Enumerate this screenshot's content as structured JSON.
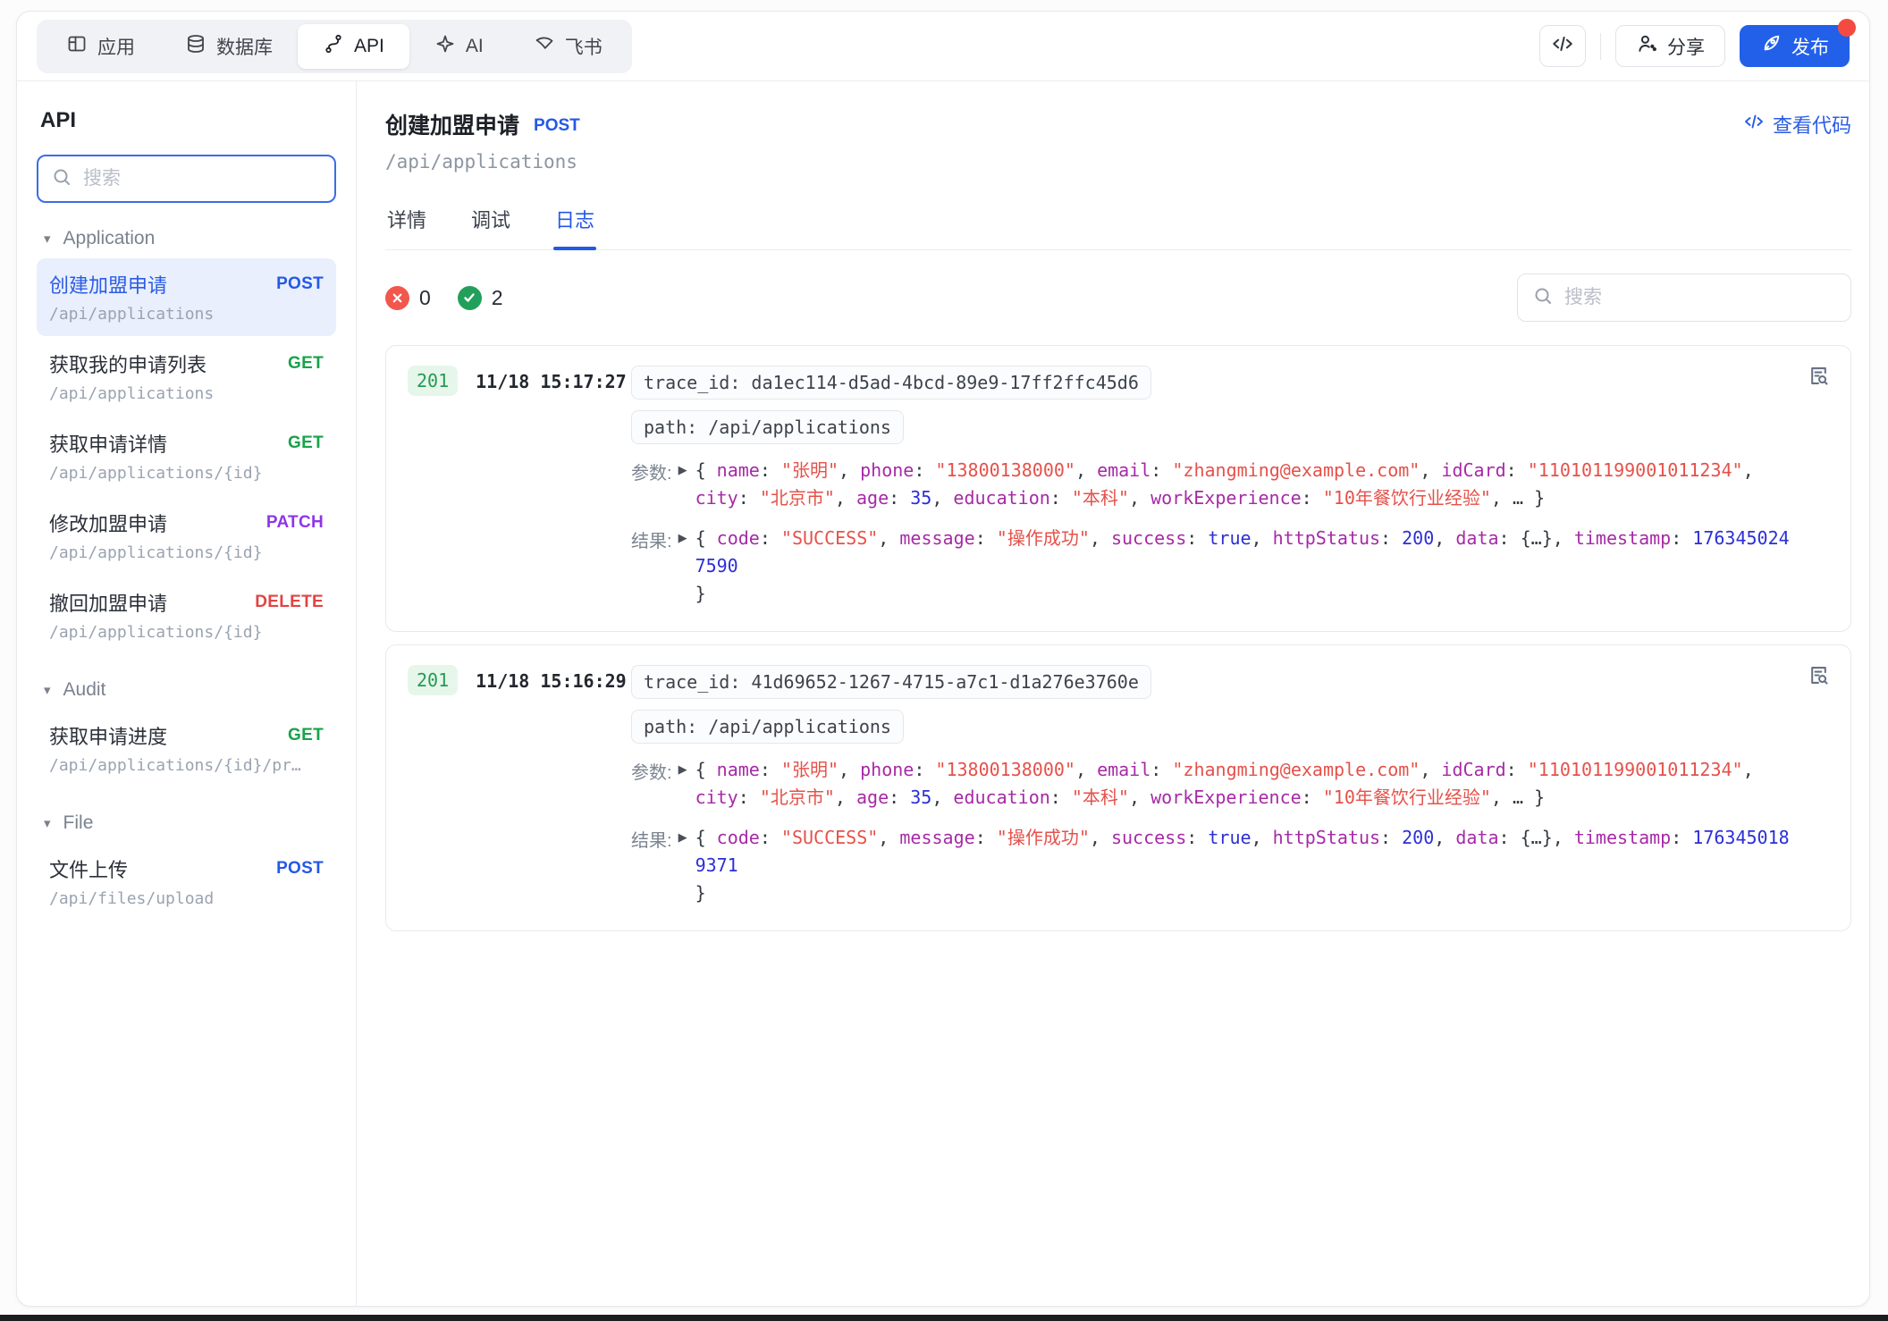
{
  "colors": {
    "accent_blue": "#2260ea",
    "method_post": "#2458e6",
    "method_get": "#17a34a",
    "method_patch": "#8f35e8",
    "method_delete": "#e04444",
    "status_success": "#22a05b",
    "status_error": "#f2574c",
    "badge_201_bg": "#e6f6eb",
    "badge_201_text": "#259a52",
    "selected_item_bg": "#e9effc"
  },
  "top_nav": {
    "tabs": [
      {
        "label": "应用",
        "icon": "app-grid-icon"
      },
      {
        "label": "数据库",
        "icon": "database-icon"
      },
      {
        "label": "API",
        "icon": "api-route-icon",
        "active": true
      },
      {
        "label": "AI",
        "icon": "ai-sparkle-icon"
      },
      {
        "label": "飞书",
        "icon": "feishu-icon"
      }
    ],
    "share_label": "分享",
    "publish_label": "发布"
  },
  "sidebar": {
    "title": "API",
    "search_placeholder": "搜索",
    "groups": [
      {
        "label": "Application",
        "items": [
          {
            "title": "创建加盟申请",
            "method": "POST",
            "path": "/api/applications",
            "selected": true
          },
          {
            "title": "获取我的申请列表",
            "method": "GET",
            "path": "/api/applications"
          },
          {
            "title": "获取申请详情",
            "method": "GET",
            "path": "/api/applications/{id}"
          },
          {
            "title": "修改加盟申请",
            "method": "PATCH",
            "path": "/api/applications/{id}"
          },
          {
            "title": "撤回加盟申请",
            "method": "DELETE",
            "path": "/api/applications/{id}"
          }
        ]
      },
      {
        "label": "Audit",
        "items": [
          {
            "title": "获取申请进度",
            "method": "GET",
            "path": "/api/applications/{id}/pr…"
          }
        ]
      },
      {
        "label": "File",
        "items": [
          {
            "title": "文件上传",
            "method": "POST",
            "path": "/api/files/upload"
          }
        ]
      }
    ]
  },
  "main": {
    "title": "创建加盟申请",
    "method": "POST",
    "path": "/api/applications",
    "view_code_label": "查看代码",
    "tabs": [
      {
        "label": "详情"
      },
      {
        "label": "调试"
      },
      {
        "label": "日志",
        "active": true
      }
    ],
    "logs": {
      "error_count": "0",
      "success_count": "2",
      "search_placeholder": "搜索",
      "params_label": "参数:",
      "result_label": "结果:",
      "entries": [
        {
          "status": "201",
          "time": "11/18 15:17:27",
          "trace_id": "trace_id: da1ec114-d5ad-4bcd-89e9-17ff2ffc45d6",
          "path": "path: /api/applications",
          "params_tokens": [
            [
              "p",
              "{ "
            ],
            [
              "k",
              "name"
            ],
            [
              "p",
              ": "
            ],
            [
              "s",
              "\"张明\""
            ],
            [
              "p",
              ", "
            ],
            [
              "k",
              "phone"
            ],
            [
              "p",
              ": "
            ],
            [
              "s",
              "\"13800138000\""
            ],
            [
              "p",
              ", "
            ],
            [
              "k",
              "email"
            ],
            [
              "p",
              ": "
            ],
            [
              "s",
              "\"zhangming@example.com\""
            ],
            [
              "p",
              ", "
            ],
            [
              "k",
              "idCard"
            ],
            [
              "p",
              ": "
            ],
            [
              "s",
              "\"110101199001011234\""
            ],
            [
              "p",
              ","
            ],
            [
              "br",
              ""
            ],
            [
              "k",
              "city"
            ],
            [
              "p",
              ": "
            ],
            [
              "s",
              "\"北京市\""
            ],
            [
              "p",
              ", "
            ],
            [
              "k",
              "age"
            ],
            [
              "p",
              ": "
            ],
            [
              "n",
              "35"
            ],
            [
              "p",
              ", "
            ],
            [
              "k",
              "education"
            ],
            [
              "p",
              ": "
            ],
            [
              "s",
              "\"本科\""
            ],
            [
              "p",
              ", "
            ],
            [
              "k",
              "workExperience"
            ],
            [
              "p",
              ": "
            ],
            [
              "s",
              "\"10年餐饮行业经验\""
            ],
            [
              "p",
              ", … }"
            ]
          ],
          "result_tokens": [
            [
              "p",
              "{ "
            ],
            [
              "k",
              "code"
            ],
            [
              "p",
              ": "
            ],
            [
              "s",
              "\"SUCCESS\""
            ],
            [
              "p",
              ", "
            ],
            [
              "k",
              "message"
            ],
            [
              "p",
              ": "
            ],
            [
              "s",
              "\"操作成功\""
            ],
            [
              "p",
              ", "
            ],
            [
              "k",
              "success"
            ],
            [
              "p",
              ": "
            ],
            [
              "n",
              "true"
            ],
            [
              "p",
              ", "
            ],
            [
              "k",
              "httpStatus"
            ],
            [
              "p",
              ": "
            ],
            [
              "n",
              "200"
            ],
            [
              "p",
              ", "
            ],
            [
              "k",
              "data"
            ],
            [
              "p",
              ": {…}, "
            ],
            [
              "k",
              "timestamp"
            ],
            [
              "p",
              ": "
            ],
            [
              "n",
              "1763450247590"
            ],
            [
              "br",
              ""
            ],
            [
              "p",
              "}"
            ]
          ]
        },
        {
          "status": "201",
          "time": "11/18 15:16:29",
          "trace_id": "trace_id: 41d69652-1267-4715-a7c1-d1a276e3760e",
          "path": "path: /api/applications",
          "params_tokens": [
            [
              "p",
              "{ "
            ],
            [
              "k",
              "name"
            ],
            [
              "p",
              ": "
            ],
            [
              "s",
              "\"张明\""
            ],
            [
              "p",
              ", "
            ],
            [
              "k",
              "phone"
            ],
            [
              "p",
              ": "
            ],
            [
              "s",
              "\"13800138000\""
            ],
            [
              "p",
              ", "
            ],
            [
              "k",
              "email"
            ],
            [
              "p",
              ": "
            ],
            [
              "s",
              "\"zhangming@example.com\""
            ],
            [
              "p",
              ", "
            ],
            [
              "k",
              "idCard"
            ],
            [
              "p",
              ": "
            ],
            [
              "s",
              "\"110101199001011234\""
            ],
            [
              "p",
              ","
            ],
            [
              "br",
              ""
            ],
            [
              "k",
              "city"
            ],
            [
              "p",
              ": "
            ],
            [
              "s",
              "\"北京市\""
            ],
            [
              "p",
              ", "
            ],
            [
              "k",
              "age"
            ],
            [
              "p",
              ": "
            ],
            [
              "n",
              "35"
            ],
            [
              "p",
              ", "
            ],
            [
              "k",
              "education"
            ],
            [
              "p",
              ": "
            ],
            [
              "s",
              "\"本科\""
            ],
            [
              "p",
              ", "
            ],
            [
              "k",
              "workExperience"
            ],
            [
              "p",
              ": "
            ],
            [
              "s",
              "\"10年餐饮行业经验\""
            ],
            [
              "p",
              ", … }"
            ]
          ],
          "result_tokens": [
            [
              "p",
              "{ "
            ],
            [
              "k",
              "code"
            ],
            [
              "p",
              ": "
            ],
            [
              "s",
              "\"SUCCESS\""
            ],
            [
              "p",
              ", "
            ],
            [
              "k",
              "message"
            ],
            [
              "p",
              ": "
            ],
            [
              "s",
              "\"操作成功\""
            ],
            [
              "p",
              ", "
            ],
            [
              "k",
              "success"
            ],
            [
              "p",
              ": "
            ],
            [
              "n",
              "true"
            ],
            [
              "p",
              ", "
            ],
            [
              "k",
              "httpStatus"
            ],
            [
              "p",
              ": "
            ],
            [
              "n",
              "200"
            ],
            [
              "p",
              ", "
            ],
            [
              "k",
              "data"
            ],
            [
              "p",
              ": {…}, "
            ],
            [
              "k",
              "timestamp"
            ],
            [
              "p",
              ": "
            ],
            [
              "n",
              "1763450189371"
            ],
            [
              "br",
              ""
            ],
            [
              "p",
              "}"
            ]
          ]
        }
      ]
    }
  }
}
